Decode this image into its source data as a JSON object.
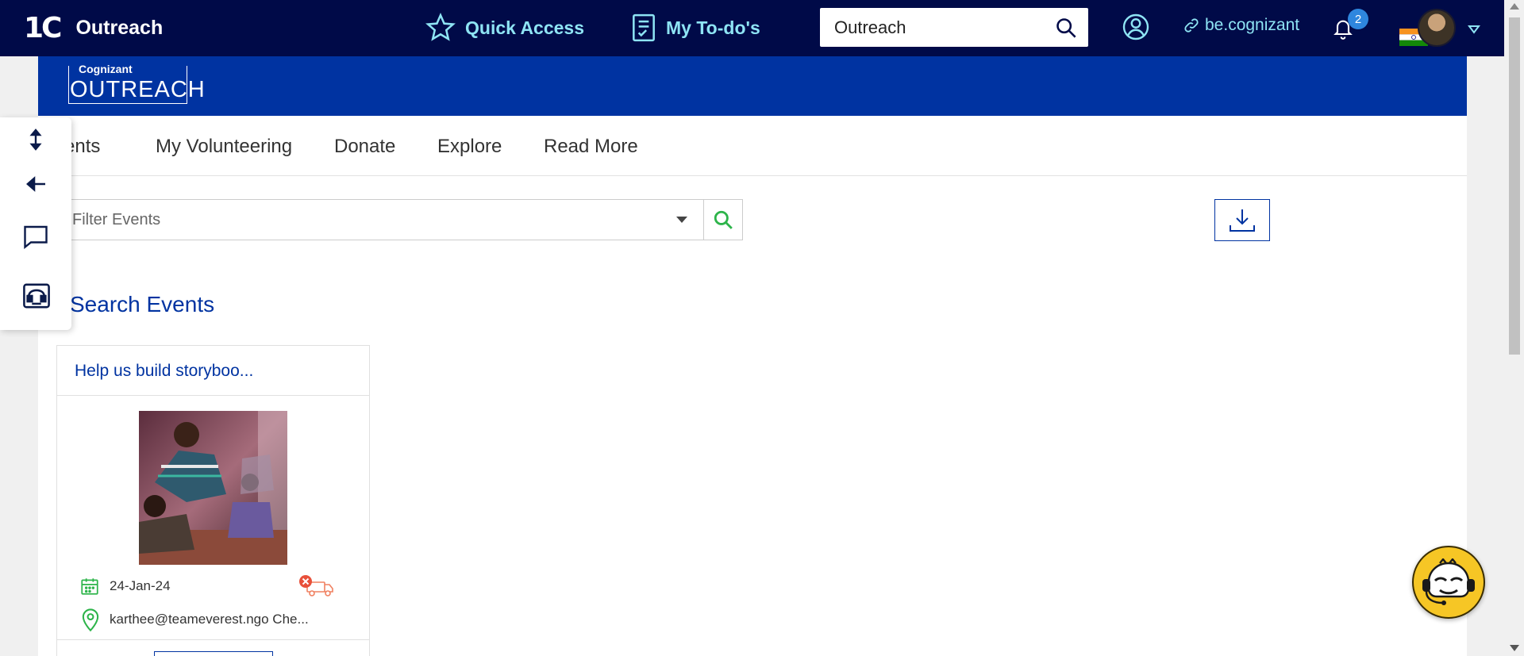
{
  "topbar": {
    "brand_logo": "1C",
    "brand_name": "Outreach",
    "quick_access": "Quick Access",
    "todos": "My To-do's",
    "search_value": "Outreach",
    "link_label": "be.cognizant",
    "notification_count": "2"
  },
  "banner": {
    "logo_small": "Cognizant",
    "logo_big": "OUTREACH"
  },
  "tabs": [
    {
      "label": "Events"
    },
    {
      "label": "My Volunteering"
    },
    {
      "label": "Donate"
    },
    {
      "label": "Explore"
    },
    {
      "label": "Read More"
    }
  ],
  "filter": {
    "placeholder": "Filter Events"
  },
  "section_title": "Search Events",
  "events": [
    {
      "title": "Help us build storyboo...",
      "date": "24-Jan-24",
      "location": "karthee@teameverest.ngo Che..."
    }
  ],
  "colors": {
    "topbar_bg": "#000a48",
    "accent_cyan": "#8ee4f4",
    "brand_blue": "#0033a1",
    "green_icon": "#2db44a",
    "bot_yellow": "#f6c625"
  }
}
